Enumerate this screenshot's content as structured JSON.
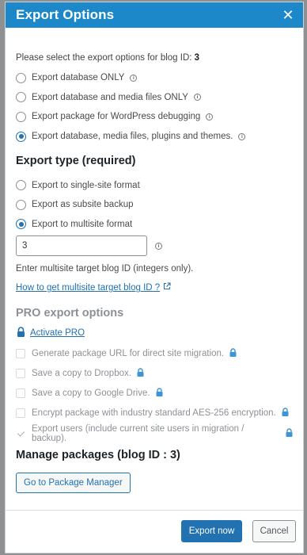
{
  "dialog": {
    "title": "Export Options",
    "close_icon": "close-icon"
  },
  "intro": {
    "text": "Please select the export options for blog ID: ",
    "blog_id": "3"
  },
  "export_options": [
    {
      "label": "Export database ONLY",
      "checked": false
    },
    {
      "label": "Export database and media files ONLY",
      "checked": false
    },
    {
      "label": "Export package for WordPress debugging",
      "checked": false
    },
    {
      "label": "Export database, media files, plugins and themes.",
      "checked": true
    }
  ],
  "export_type": {
    "title": "Export type (required)",
    "options": [
      {
        "label": "Export to single-site format",
        "checked": false
      },
      {
        "label": "Export as subsite backup",
        "checked": false
      },
      {
        "label": "Export to multisite format",
        "checked": true
      }
    ],
    "target_blog_id_value": "3",
    "help_text": "Enter multisite target blog ID (integers only).",
    "help_link": "How to get multisite target blog ID ?"
  },
  "pro": {
    "title": "PRO export options",
    "activate_label": "Activate PRO",
    "options": [
      {
        "label": "Generate package URL for direct site migration.",
        "checked": false
      },
      {
        "label": "Save a copy to Dropbox.",
        "checked": false
      },
      {
        "label": "Save a copy to Google Drive.",
        "checked": false
      },
      {
        "label": "Encrypt package with industry standard AES-256 encryption.",
        "checked": false
      },
      {
        "label": "Export users (include current site users in migration / backup).",
        "checked": true
      }
    ]
  },
  "manage": {
    "title": "Manage packages (blog ID : 3)",
    "button_label": "Go to Package Manager"
  },
  "footer": {
    "export_label": "Export now",
    "cancel_label": "Cancel"
  },
  "colors": {
    "title_bar": "#1c87c9",
    "accent": "#2271b1",
    "disabled_text": "#8d9196",
    "overlay": "#8f9091"
  }
}
